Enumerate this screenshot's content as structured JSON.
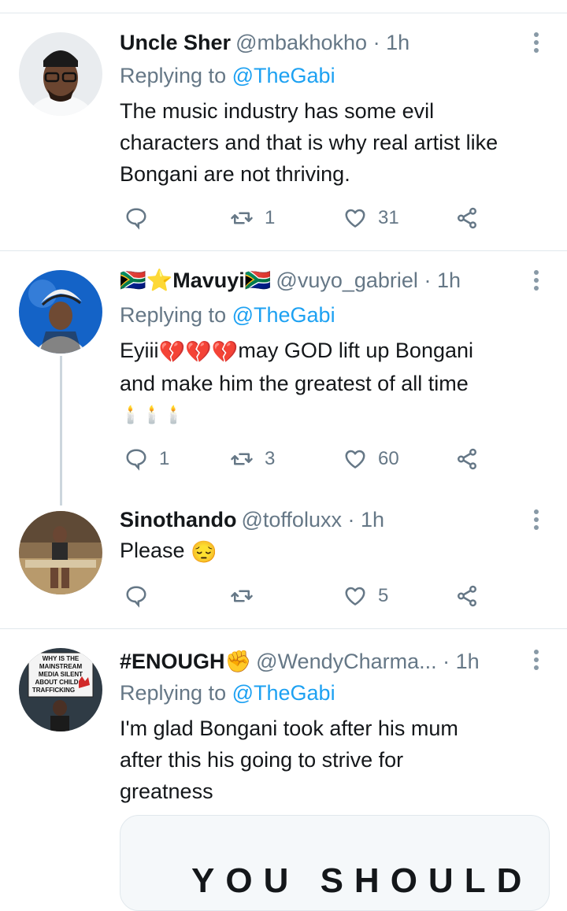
{
  "tweets": [
    {
      "name": "Uncle Sher",
      "handle": "@mbakhokho",
      "time": "· 1h",
      "replying_label": "Replying to",
      "replying_to": "@TheGabi",
      "text_lines": [
        "The music industry has some evil",
        "characters and that is why real artist like",
        "Bongani are not thriving."
      ],
      "replies": "",
      "retweets": "1",
      "likes": "31"
    },
    {
      "name_flag_left": "🇿🇦",
      "name_star": "⭐",
      "name": "Mavuyi",
      "name_flag_right": "🇿🇦",
      "handle": "@vuyo_gabriel",
      "time": "· 1h",
      "replying_label": "Replying to",
      "replying_to": "@TheGabi",
      "text_line1_a": "Eyiii",
      "text_line1_emoji": "💔💔💔",
      "text_line1_b": "may GOD lift up Bongani",
      "text_line2": "and make him the greatest of all time",
      "candles": "🕯️🕯️🕯️",
      "replies": "1",
      "retweets": "3",
      "likes": "60"
    },
    {
      "name": "Sinothando",
      "handle": "@toffoluxx",
      "time": "· 1h",
      "text": "Please",
      "text_emoji": "😔",
      "replies": "",
      "retweets": "",
      "likes": "5"
    },
    {
      "name": "#ENOUGH",
      "name_emoji": "✊",
      "handle": "@WendyCharma...",
      "time": "· 1h",
      "replying_label": "Replying to",
      "replying_to": "@TheGabi",
      "text_lines": [
        "I'm glad Bongani took after his mum",
        "after this his going to strive for",
        "greatness"
      ],
      "avatar_sign_lines": [
        "WHY IS THE",
        "MAINSTREAM",
        "MEDIA SILENT",
        "ABOUT CHILD",
        "TRAFFICKING"
      ],
      "media_text": "YOU SHOULD"
    }
  ],
  "icons": {
    "reply": "reply-icon",
    "retweet": "retweet-icon",
    "like": "like-icon",
    "share": "share-icon",
    "more": "more-vertical-icon"
  },
  "colors": {
    "link": "#1da1f2",
    "muted": "#657786",
    "divider": "#e1e8ed"
  }
}
